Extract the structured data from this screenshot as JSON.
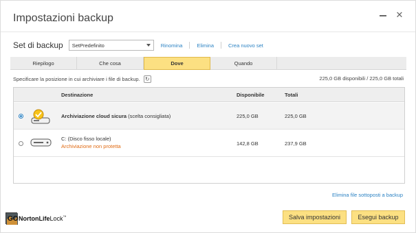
{
  "window": {
    "title": "Impostazioni backup"
  },
  "set": {
    "label": "Set di backup",
    "selected": "SetPredefinito",
    "links": {
      "rename": "Rinomina",
      "delete": "Elimina",
      "create": "Crea nuovo set"
    }
  },
  "tabs": [
    {
      "label": "Riepilogo",
      "active": false
    },
    {
      "label": "Che cosa",
      "active": false
    },
    {
      "label": "Dove",
      "active": true
    },
    {
      "label": "Quando",
      "active": false
    }
  ],
  "hint": "Specificare la posizione in cui archiviare i file di backup.",
  "availability": "225,0 GB disponibili / 225,0 GB totali",
  "table": {
    "headers": {
      "destination": "Destinazione",
      "available": "Disponibile",
      "total": "Totali"
    },
    "rows": [
      {
        "name": "Archiviazione cloud sicura",
        "note": "(scelta consigliata)",
        "warning": "",
        "available": "225,0 GB",
        "total": "225,0 GB",
        "selected": true,
        "icon": "cloud-drive-icon"
      },
      {
        "name": "C: (Disco fisso locale)",
        "note": "",
        "warning": "Archiviazione non protetta",
        "available": "142,8 GB",
        "total": "237,9 GB",
        "selected": false,
        "icon": "hard-drive-icon"
      }
    ]
  },
  "delete_link": "Elimina file sottoposti a backup",
  "brand": {
    "name_bold": "NortonLife",
    "name_light": "Lock",
    "tm": "™",
    "overlay": "GO"
  },
  "buttons": {
    "save": "Salva impostazioni",
    "run": "Esegui backup"
  },
  "colors": {
    "accent": "#fce082",
    "link": "#2b82c3",
    "warning": "#e06a12"
  }
}
